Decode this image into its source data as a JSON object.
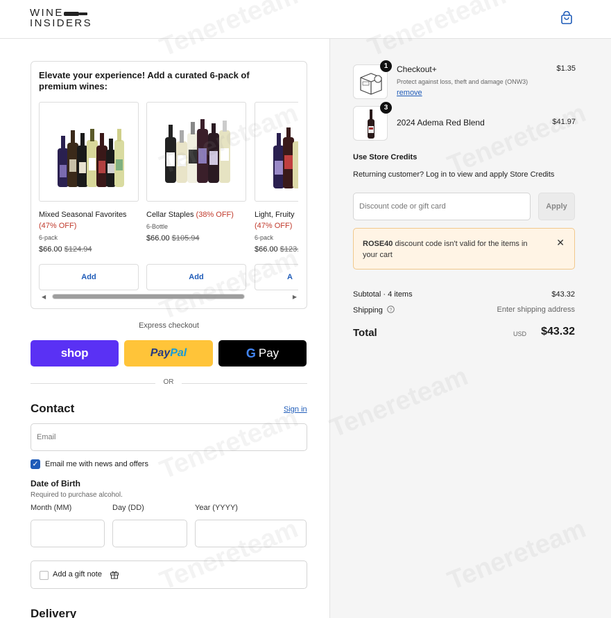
{
  "header": {
    "logo_line1": "WINE",
    "logo_line2": "INSIDERS"
  },
  "upsell": {
    "title": "Elevate your experience! Add a curated 6-pack of premium wines:",
    "products": [
      {
        "name": "Mixed Seasonal Favorites",
        "discount": "(47% OFF)",
        "pack": "6-pack",
        "price": "$66.00",
        "old_price": "$124.94",
        "add_label": "Add"
      },
      {
        "name": "Cellar Staples",
        "discount": "(38% OFF)",
        "pack": "6-Bottle",
        "price": "$66.00",
        "old_price": "$105.94",
        "add_label": "Add"
      },
      {
        "name": "Light, Fruity",
        "discount": "(47% OFF)",
        "pack": "6-pack",
        "price": "$66.00",
        "old_price": "$123.",
        "add_label": "A"
      }
    ]
  },
  "express": {
    "label": "Express checkout",
    "shop_label": "shop",
    "paypal_part1": "Pay",
    "paypal_part2": "Pal",
    "gpay_g": "G",
    "gpay_label": "Pay",
    "or_label": "OR"
  },
  "contact": {
    "title": "Contact",
    "sign_in": "Sign in",
    "email_placeholder": "Email",
    "newsletter_label": "Email me with news and offers",
    "newsletter_checked": true
  },
  "dob": {
    "title": "Date of Birth",
    "note": "Required to purchase alcohol.",
    "month_label": "Month (MM)",
    "day_label": "Day (DD)",
    "year_label": "Year (YYYY)"
  },
  "gift": {
    "label": "Add a gift note"
  },
  "delivery": {
    "title": "Delivery"
  },
  "order": {
    "items": [
      {
        "qty": "1",
        "name": "Checkout+",
        "desc": "Protect against loss, theft and damage (ONW3)",
        "remove": "remove",
        "price": "$1.35"
      },
      {
        "qty": "3",
        "name": "2024 Adema Red Blend",
        "price": "$41.97"
      }
    ],
    "credits_title": "Use Store Credits",
    "credits_text": "Returning customer? Log in to view and apply Store Credits",
    "discount_placeholder": "Discount code or gift card",
    "apply_label": "Apply",
    "alert_code": "ROSE40",
    "alert_text": " discount code isn't valid for the items in your cart",
    "subtotal_label": "Subtotal · 4 items",
    "subtotal_value": "$43.32",
    "shipping_label": "Shipping",
    "shipping_value": "Enter shipping address",
    "total_label": "Total",
    "currency": "USD",
    "total_value": "$43.32"
  },
  "watermark": "Tenereteam"
}
